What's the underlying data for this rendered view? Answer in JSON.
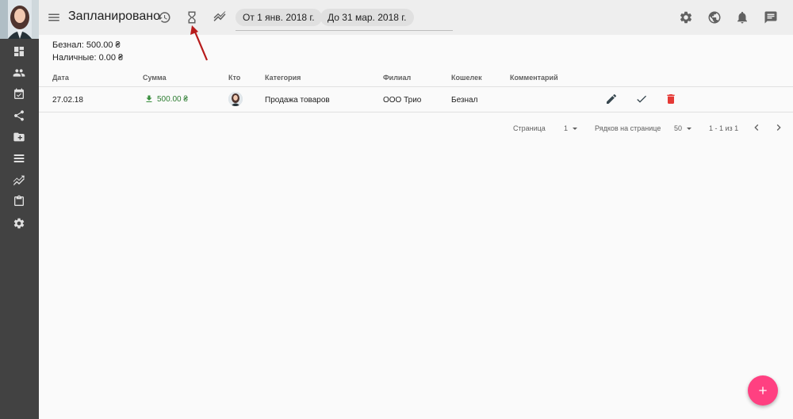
{
  "header": {
    "title": "Запланировано",
    "date_from": "От 1 янв. 2018 г.",
    "date_to": "До 31 мар. 2018 г."
  },
  "summary": {
    "cashless": "Безнал: 500.00 ₴",
    "cash": "Наличные: 0.00 ₴"
  },
  "table": {
    "columns": [
      "Дата",
      "Сумма",
      "Кто",
      "Категория",
      "Филиал",
      "Кошелек",
      "Комментарий"
    ],
    "rows": [
      {
        "date": "27.02.18",
        "amount": "500.00 ₴",
        "category": "Продажа товаров",
        "branch": "ООО Трио",
        "wallet": "Безнал",
        "comment": ""
      }
    ]
  },
  "pagination": {
    "page_label": "Страница",
    "page_value": "1",
    "rows_label": "Рядков на странице",
    "rows_value": "50",
    "range": "1 - 1 из 1"
  },
  "colors": {
    "accent": "#ff4081",
    "sidebar": "#424242",
    "positive": "#388e3c",
    "delete": "#e53935",
    "annotation_arrow": "#b71c1c"
  },
  "icons": {
    "sidebar": [
      "dashboard-icon",
      "people-icon",
      "event-check-icon",
      "share-icon",
      "folder-icon",
      "list-icon",
      "trending-icon",
      "clipboard-icon",
      "settings-icon"
    ],
    "topbar": [
      "menu-icon",
      "history-icon",
      "hourglass-icon",
      "trend-icon",
      "settings-icon",
      "globe-icon",
      "bell-icon",
      "chat-icon"
    ]
  }
}
